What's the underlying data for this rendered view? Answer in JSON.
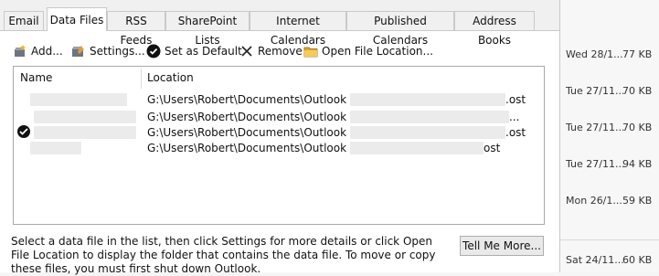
{
  "tabs": [
    {
      "label": "Email"
    },
    {
      "label": "Data Files"
    },
    {
      "label": "RSS Feeds"
    },
    {
      "label": "SharePoint Lists"
    },
    {
      "label": "Internet Calendars"
    },
    {
      "label": "Published Calendars"
    },
    {
      "label": "Address Books"
    }
  ],
  "active_tab": "Data Files",
  "toolbar": {
    "add": "Add...",
    "settings": "Settings...",
    "set_default": "Set as Default",
    "remove": "Remove",
    "open_location": "Open File Location..."
  },
  "columns": {
    "name": "Name",
    "location": "Location"
  },
  "rows": [
    {
      "path": "G:\\Users\\Robert\\Documents\\Outlook Files\\",
      "suffix": ".ost",
      "default": false
    },
    {
      "path": "G:\\Users\\Robert\\Documents\\Outlook Files\\",
      "suffix": "...",
      "default": false
    },
    {
      "path": "G:\\Users\\Robert\\Documents\\Outlook Files\\",
      "suffix": ".ost",
      "default": true
    },
    {
      "path": "G:\\Users\\Robert\\Documents\\Outlook Files\\",
      "suffix": "ost",
      "default": false
    }
  ],
  "help_text": "Select a data file in the list, then click Settings for more details or click Open File Location to display the folder that contains the data file. To move or copy these files, you must first shut down Outlook.",
  "tell_me_more": "Tell Me More...",
  "messages": [
    {
      "date": "Wed 28/1...",
      "size": "77 KB"
    },
    {
      "date": "Tue 27/11...",
      "size": "70 KB"
    },
    {
      "date": "Tue 27/11...",
      "size": "70 KB"
    },
    {
      "date": "Tue 27/11...",
      "size": "94 KB"
    },
    {
      "date": "Mon 26/1...",
      "size": "59 KB"
    },
    {
      "date": "Sat 24/11...",
      "size": "60 KB"
    }
  ]
}
